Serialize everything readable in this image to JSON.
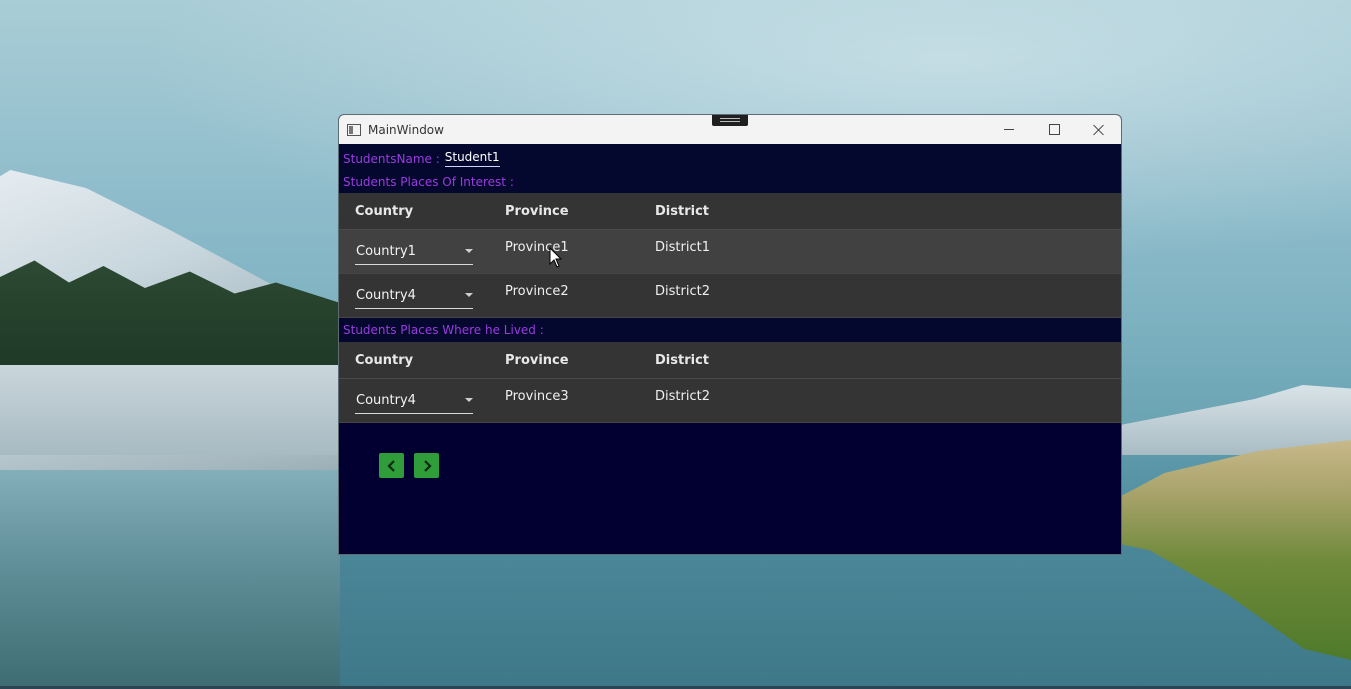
{
  "window": {
    "title": "MainWindow"
  },
  "student": {
    "name_label": "StudentsName :",
    "name_value": "Student1"
  },
  "interest": {
    "label": "Students Places Of Interest :",
    "columns": [
      "Country",
      "Province",
      "District"
    ],
    "rows": [
      {
        "country": "Country1",
        "province": "Province1",
        "district": "District1"
      },
      {
        "country": "Country4",
        "province": "Province2",
        "district": "District2"
      }
    ]
  },
  "lived": {
    "label": "Students Places Where he Lived :",
    "columns": [
      "Country",
      "Province",
      "District"
    ],
    "rows": [
      {
        "country": "Country4",
        "province": "Province3",
        "district": "District2"
      }
    ]
  },
  "nav": {
    "prev_icon": "chevron-left-icon",
    "next_icon": "chevron-right-icon"
  },
  "colors": {
    "label_purple": "#9b3be0",
    "window_bg": "#03003f",
    "grid_bg": "#343434",
    "nav_green": "#2e9d3a"
  }
}
